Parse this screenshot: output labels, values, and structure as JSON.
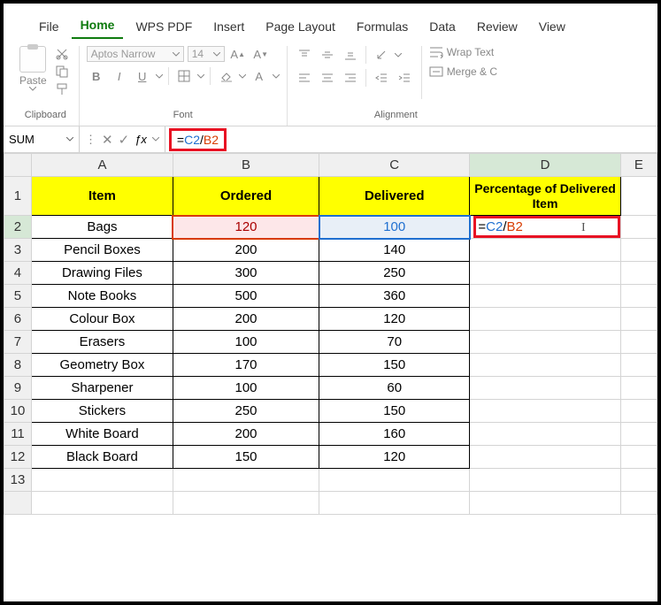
{
  "menu": {
    "tabs": [
      "File",
      "Home",
      "WPS PDF",
      "Insert",
      "Page Layout",
      "Formulas",
      "Data",
      "Review",
      "View"
    ],
    "active": "Home"
  },
  "ribbon": {
    "clipboard": {
      "paste": "Paste",
      "label": "Clipboard"
    },
    "font": {
      "name": "Aptos Narrow",
      "size": "14",
      "label": "Font",
      "bold": "B",
      "italic": "I",
      "underline": "U"
    },
    "alignment": {
      "label": "Alignment",
      "wrap": "Wrap Text",
      "merge": "Merge & C"
    }
  },
  "formula_bar": {
    "name_box": "SUM",
    "formula_parts": {
      "eq": "=",
      "c2": "C2",
      "slash": "/",
      "b2": "B2"
    }
  },
  "columns": [
    "A",
    "B",
    "C",
    "D",
    "E"
  ],
  "headers": {
    "A": "Item",
    "B": "Ordered",
    "C": "Delivered",
    "D": "Percentage of Delivered Item"
  },
  "rows": [
    {
      "n": 1
    },
    {
      "n": 2,
      "A": "Bags",
      "B": "120",
      "C": "100",
      "D_formula": true
    },
    {
      "n": 3,
      "A": "Pencil Boxes",
      "B": "200",
      "C": "140"
    },
    {
      "n": 4,
      "A": "Drawing Files",
      "B": "300",
      "C": "250"
    },
    {
      "n": 5,
      "A": "Note Books",
      "B": "500",
      "C": "360"
    },
    {
      "n": 6,
      "A": "Colour Box",
      "B": "200",
      "C": "120"
    },
    {
      "n": 7,
      "A": "Erasers",
      "B": "100",
      "C": "70"
    },
    {
      "n": 8,
      "A": "Geometry Box",
      "B": "170",
      "C": "150"
    },
    {
      "n": 9,
      "A": "Sharpener",
      "B": "100",
      "C": "60"
    },
    {
      "n": 10,
      "A": "Stickers",
      "B": "250",
      "C": "150"
    },
    {
      "n": 11,
      "A": "White Board",
      "B": "200",
      "C": "160"
    },
    {
      "n": 12,
      "A": "Black Board",
      "B": "150",
      "C": "120"
    },
    {
      "n": 13
    }
  ]
}
